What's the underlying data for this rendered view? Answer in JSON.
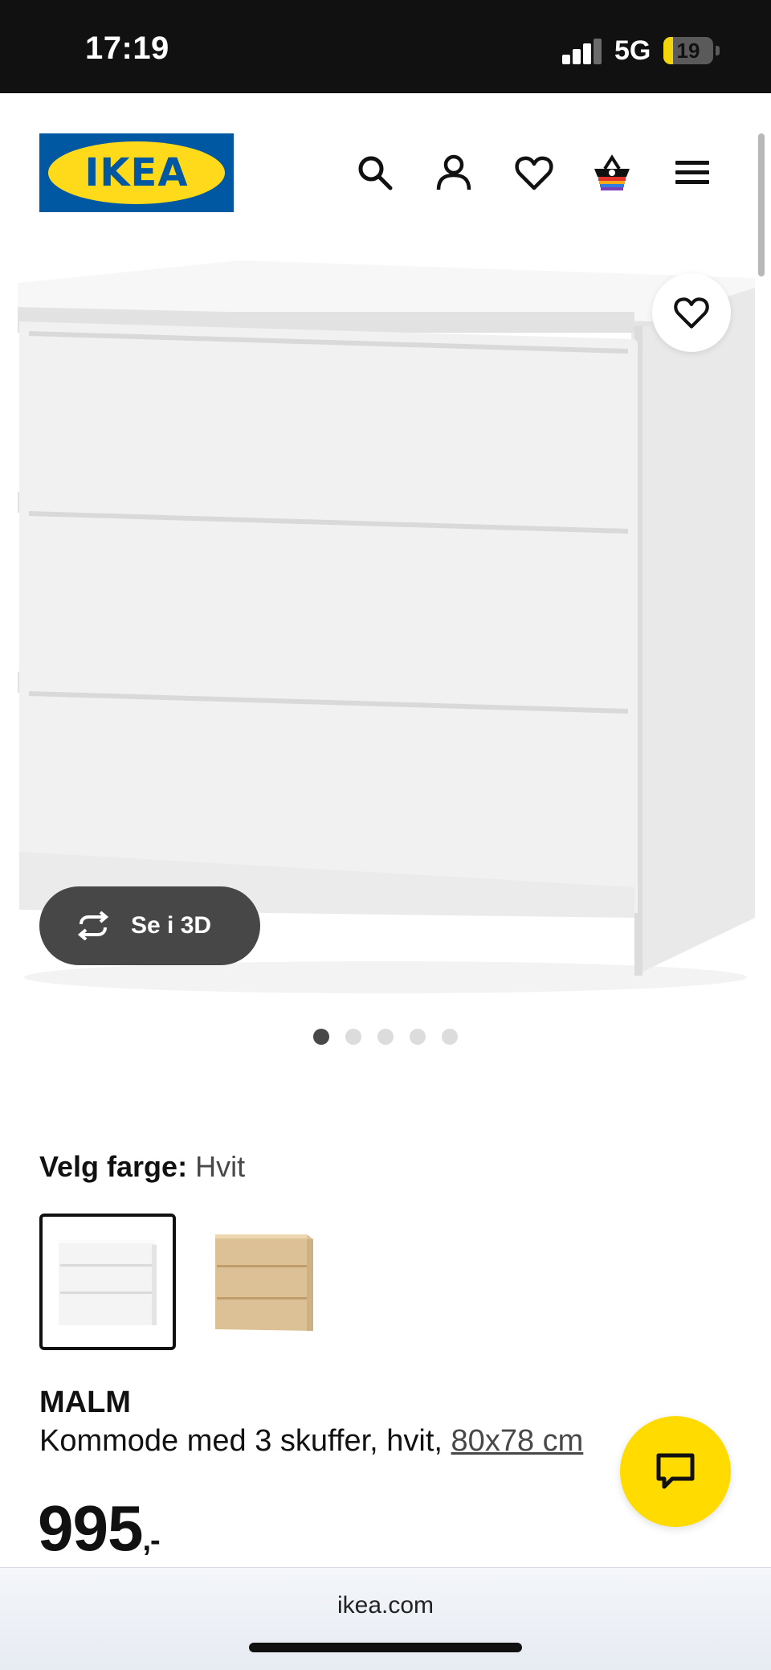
{
  "status_bar": {
    "time": "17:19",
    "network": "5G",
    "battery": "19",
    "battery_level_percent": 19
  },
  "header": {
    "logo_text": "IKEA",
    "brand_colors": {
      "blue": "#0058a3",
      "yellow": "#ffda1a"
    },
    "icons": [
      "search-icon",
      "user-icon",
      "heart-icon",
      "basket-icon",
      "menu-icon"
    ]
  },
  "product_gallery": {
    "image_subject": "white 3-drawer chest",
    "view_3d_label": "Se i 3D",
    "view_3d_icon": "rotate-icon",
    "favorite_icon": "heart-icon",
    "dots_total": 5,
    "dots_active_index": 0
  },
  "color_picker": {
    "label": "Velg farge:",
    "selected_value": "Hvit",
    "options": [
      {
        "name": "white",
        "color": "#f3f3f3",
        "selected": true
      },
      {
        "name": "oak",
        "color": "#ddc196",
        "selected": false
      }
    ]
  },
  "product": {
    "name": "MALM",
    "description": "Kommode med 3 skuffer, hvit, ",
    "size": "80x78 cm",
    "price": "995",
    "price_suffix": ",-"
  },
  "chat": {
    "icon": "chat-icon",
    "color": "#ffdb00"
  },
  "browser": {
    "url": "ikea.com"
  }
}
